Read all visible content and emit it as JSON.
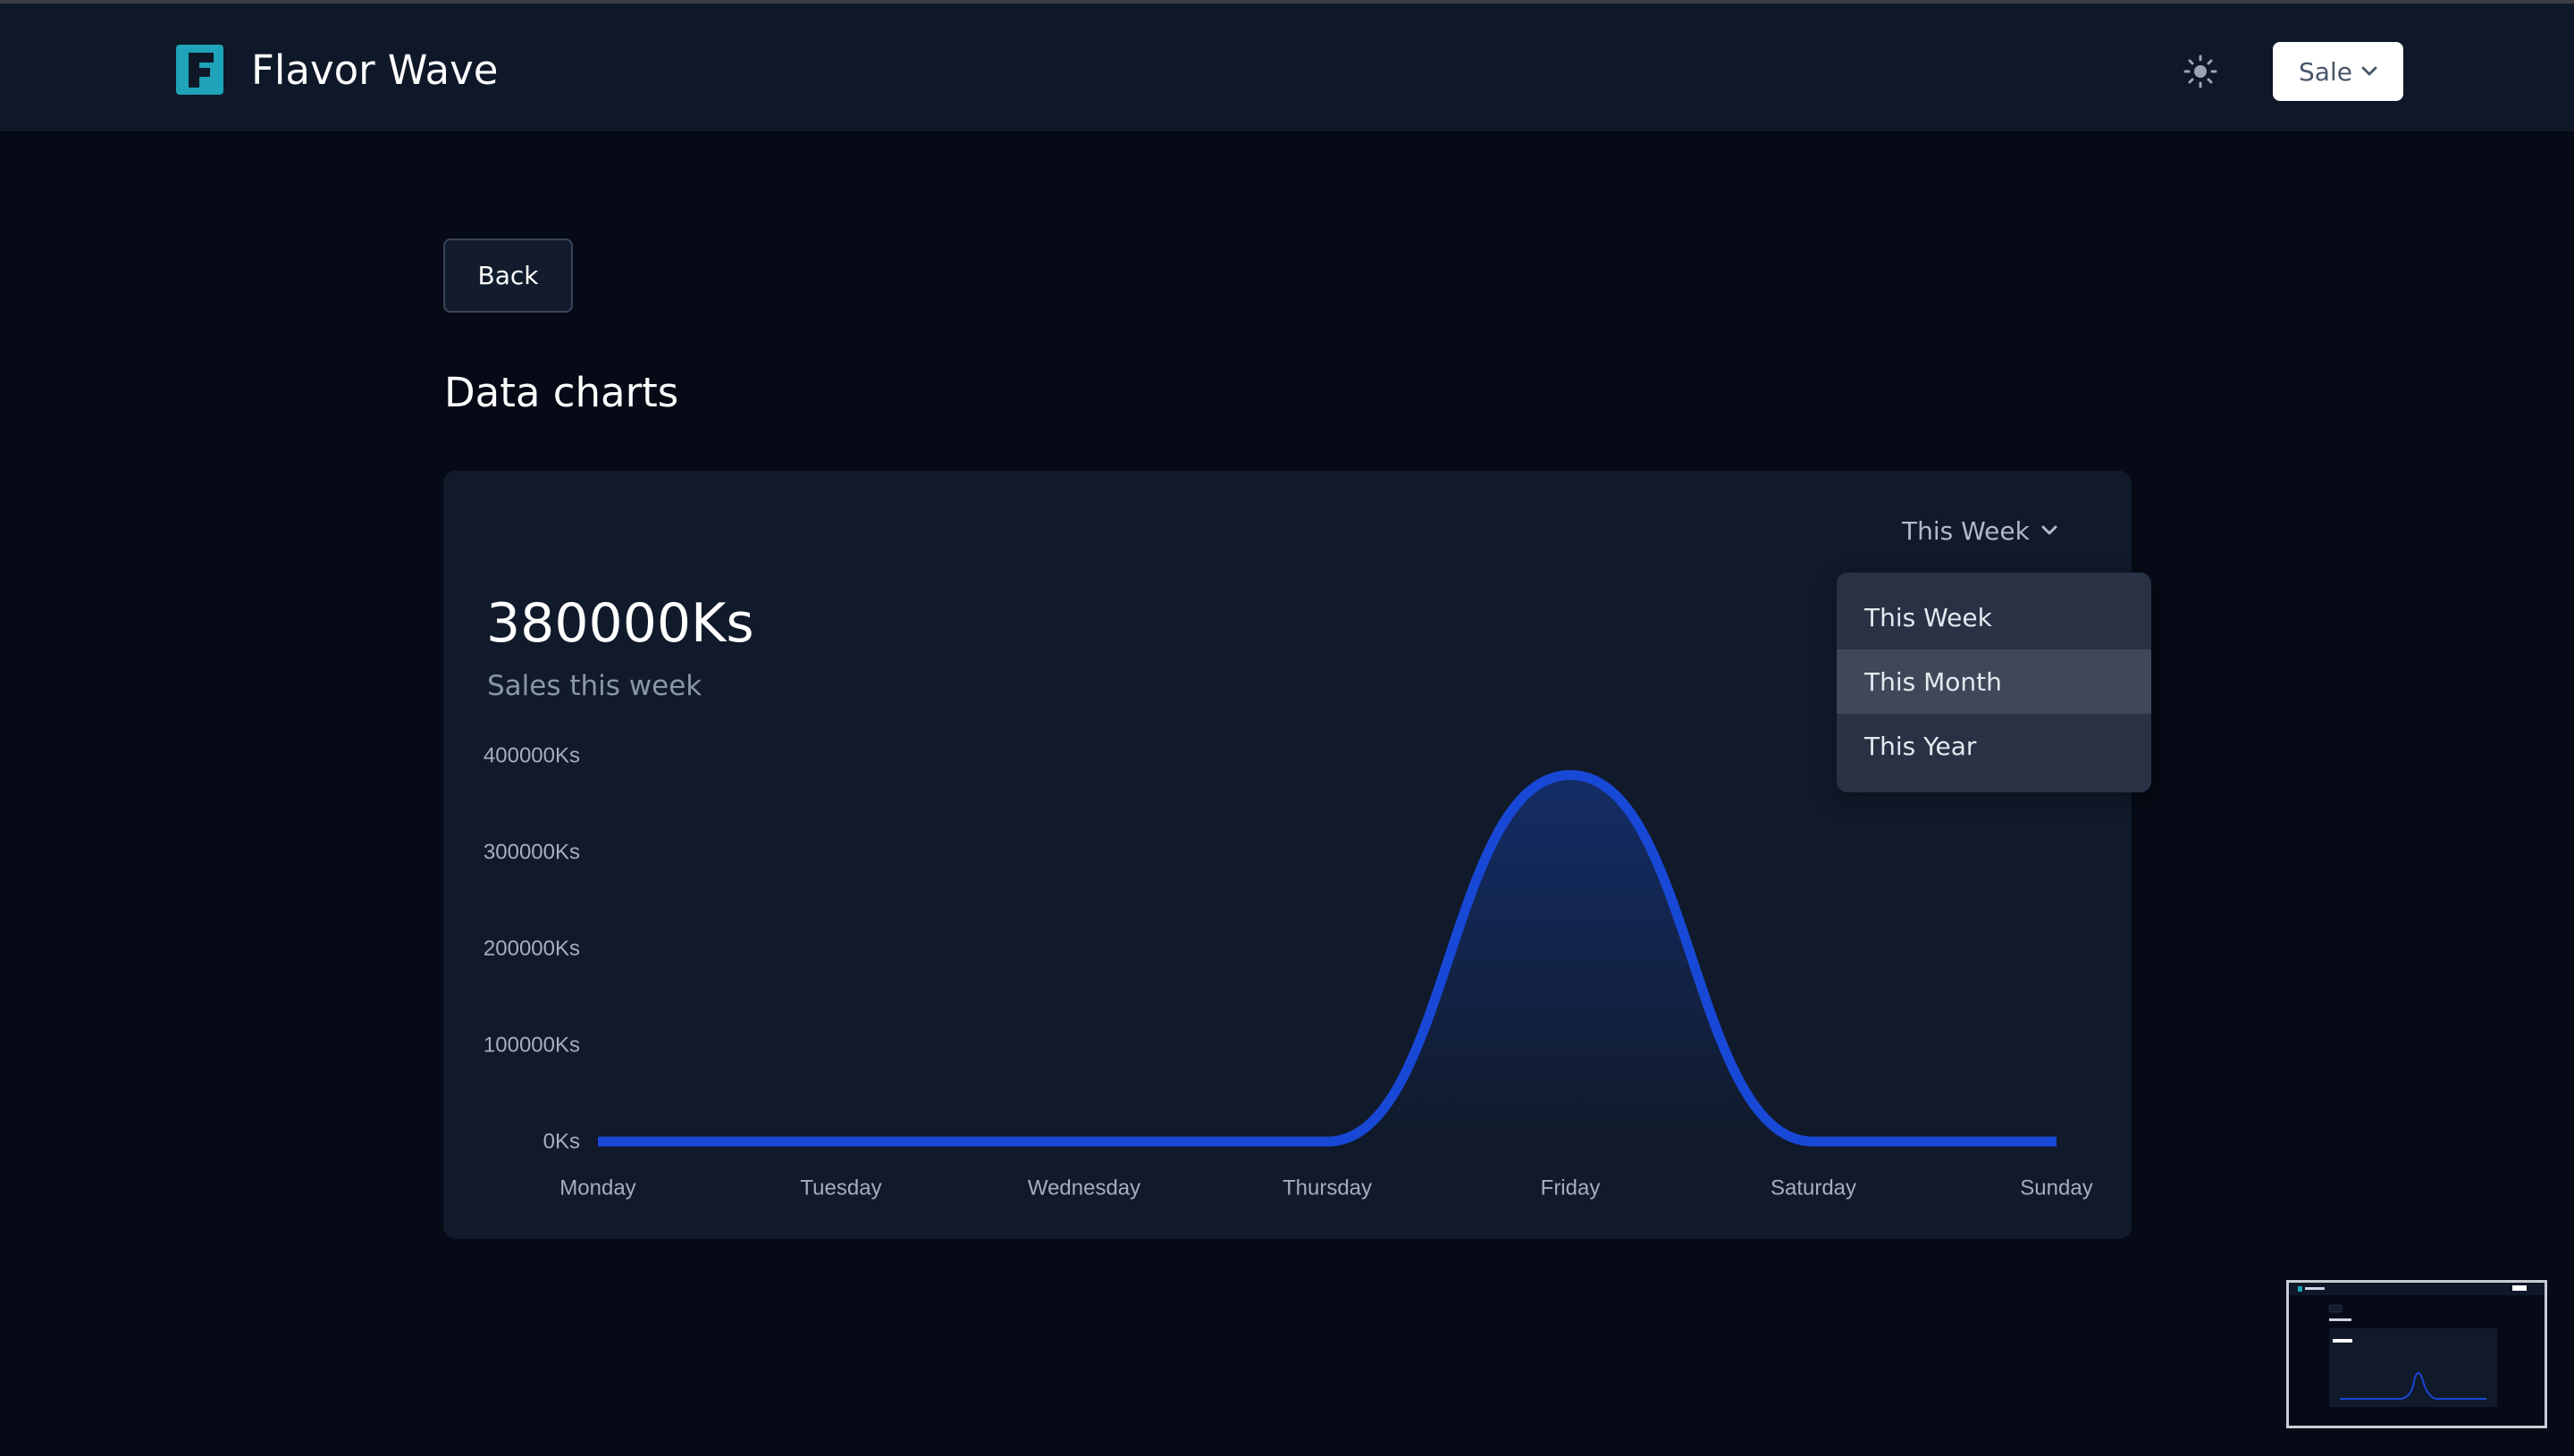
{
  "app": {
    "title": "Flavor Wave",
    "accent_color": "#1ea3b8",
    "logo_letter": "F"
  },
  "header": {
    "theme_icon": "sun-icon",
    "menu_label": "Sale",
    "menu_icon": "chevron-down-icon"
  },
  "page": {
    "back_label": "Back",
    "title": "Data charts"
  },
  "card": {
    "period_selected": "This Week",
    "total_value": "380000Ks",
    "total_caption": "Sales this week",
    "period_options": [
      {
        "label": "This Week",
        "highlighted": false
      },
      {
        "label": "This Month",
        "highlighted": true
      },
      {
        "label": "This Year",
        "highlighted": false
      }
    ]
  },
  "chart_data": {
    "type": "area",
    "categories": [
      "Monday",
      "Tuesday",
      "Wednesday",
      "Thursday",
      "Friday",
      "Saturday",
      "Sunday"
    ],
    "series": [
      {
        "values": [
          0,
          0,
          0,
          0,
          380000,
          0,
          0
        ]
      }
    ],
    "y_ticks": [
      "0Ks",
      "100000Ks",
      "200000Ks",
      "300000Ks",
      "400000Ks"
    ],
    "y_tick_values": [
      0,
      100000,
      200000,
      300000,
      400000
    ],
    "ylim": [
      0,
      400000
    ],
    "grid": false,
    "line_color": "#1848d6",
    "fill_color": "#163a8f"
  }
}
